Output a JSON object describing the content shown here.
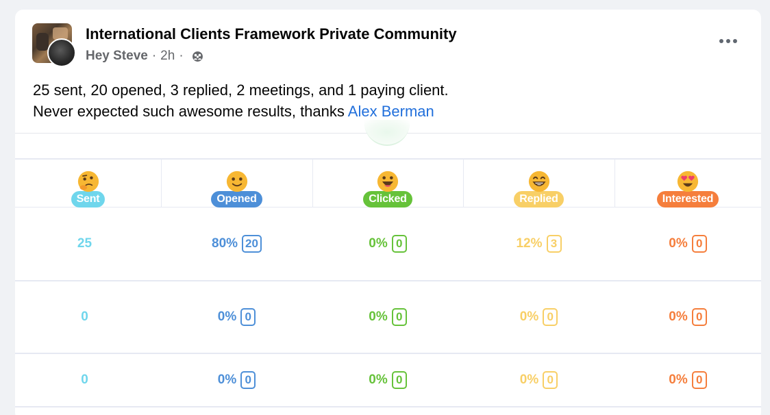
{
  "post": {
    "group_name": "International Clients Framework Private Community",
    "author": "Hey Steve",
    "time": "2h",
    "separator": "·",
    "line1": "25 sent, 20 opened, 3 replied, 2 meetings, and 1 paying client.",
    "line2_prefix": "Never expected such awesome results, thanks ",
    "mention": "Alex Berman"
  },
  "table": {
    "columns": [
      {
        "label": "Sent",
        "color": "#6fd6ec",
        "emoji": "thinking-face-icon"
      },
      {
        "label": "Opened",
        "color": "#4d8fd8",
        "emoji": "smiling-face-icon"
      },
      {
        "label": "Clicked",
        "color": "#66c23a",
        "emoji": "grinning-face-icon"
      },
      {
        "label": "Replied",
        "color": "#f8cf66",
        "emoji": "beaming-face-icon"
      },
      {
        "label": "Interested",
        "color": "#f57e3c",
        "emoji": "heart-eyes-face-icon"
      }
    ],
    "rows": [
      {
        "sent": "25",
        "opened_pct": "80%",
        "opened_count": "20",
        "clicked_pct": "0%",
        "clicked_count": "0",
        "replied_pct": "12%",
        "replied_count": "3",
        "interested_pct": "0%",
        "interested_count": "0"
      },
      {
        "sent": "0",
        "opened_pct": "0%",
        "opened_count": "0",
        "clicked_pct": "0%",
        "clicked_count": "0",
        "replied_pct": "0%",
        "replied_count": "0",
        "interested_pct": "0%",
        "interested_count": "0"
      },
      {
        "sent": "0",
        "opened_pct": "0%",
        "opened_count": "0",
        "clicked_pct": "0%",
        "clicked_count": "0",
        "replied_pct": "0%",
        "replied_count": "0",
        "interested_pct": "0%",
        "interested_count": "0"
      }
    ]
  }
}
